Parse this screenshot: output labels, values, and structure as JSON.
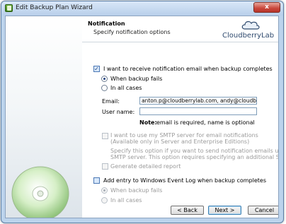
{
  "window": {
    "title": "Edit Backup Plan Wizard",
    "close_glyph": "x"
  },
  "header": {
    "title": "Notification",
    "subtitle": "Specify notification options",
    "logo_text": "CloudberryLab"
  },
  "options": {
    "receive_email": {
      "label": "I want to receive notification email when backup completes",
      "checked": true
    },
    "when_fails": {
      "label": "When backup fails",
      "selected": true
    },
    "all_cases": {
      "label": "In all cases",
      "selected": false
    },
    "email_label": "Email:",
    "email_value": "anton.p@cloudberrylab.com, andy@cloudberrylab.com",
    "username_label": "User name:",
    "username_value": "",
    "note_bold": "Note:",
    "note_text": "email is required, name is optional",
    "smtp": {
      "line1": "I want to use my SMTP server for email notifications",
      "line2": "(Available only in Server and Enterprise Editions)",
      "enabled": false
    },
    "smtp_desc": {
      "line1": "Specify this option if you want to send notification emails using your own",
      "line2": "SMTP server. This option requires specifying an additional SMTP settings"
    },
    "detailed_report": {
      "label": "Generate detailed report",
      "enabled": false
    },
    "event_log": {
      "label": "Add entry to Windows Event Log when backup completes",
      "checked": false
    },
    "event_fails": {
      "label": "When backup fails"
    },
    "event_all": {
      "label": "In all cases"
    }
  },
  "footer": {
    "back": "< Back",
    "next": "Next >",
    "cancel": "Cancel"
  },
  "colors": {
    "accent": "#1c3f7a",
    "title_bar": "#bcd3ec",
    "logo": "#2f4a6e"
  },
  "icons": {
    "app": "backup-wizard-icon",
    "disc": "cd-disc-icon",
    "logo": "cloud-logo-icon"
  }
}
